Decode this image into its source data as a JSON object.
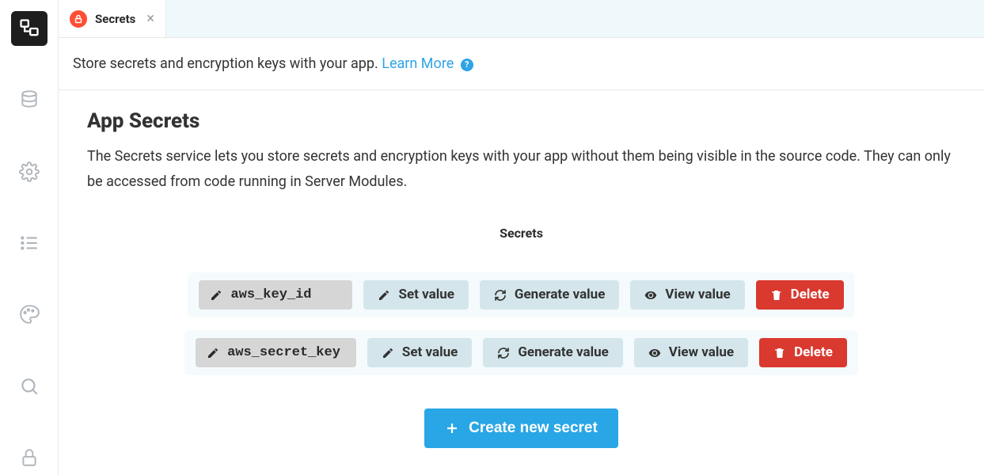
{
  "tab": {
    "label": "Secrets"
  },
  "intro": {
    "text": "Store secrets and encryption keys with your app.",
    "learn_more": "Learn More"
  },
  "panel": {
    "title": "App Secrets",
    "description": "The Secrets service lets you store secrets and encryption keys with your app without them being visible in the source code. They can only be accessed from code running in Server Modules.",
    "table_heading": "Secrets"
  },
  "secrets": [
    {
      "name": "aws_key_id",
      "set_label": "Set value",
      "gen_label": "Generate value",
      "view_label": "View value",
      "delete_label": "Delete"
    },
    {
      "name": "aws_secret_key",
      "set_label": "Set value",
      "gen_label": "Generate value",
      "view_label": "View value",
      "delete_label": "Delete"
    }
  ],
  "create_label": "Create new secret"
}
